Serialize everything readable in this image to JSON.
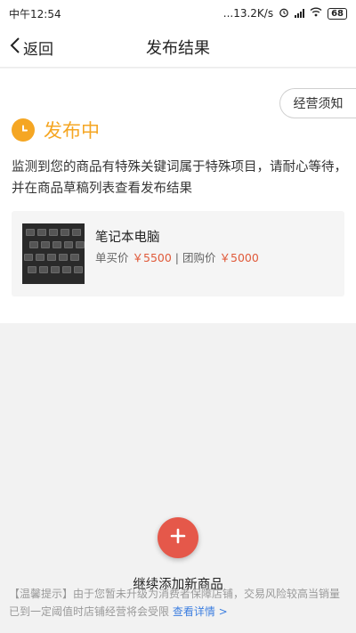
{
  "status_bar": {
    "time": "中午12:54",
    "network_speed": "...13.2K/s",
    "battery": "68"
  },
  "nav": {
    "back_label": "返回",
    "title": "发布结果"
  },
  "result": {
    "notice_button": "经营须知",
    "status": "发布中",
    "status_color": "#f5a623",
    "description": "监测到您的商品有特殊关键词属于特殊项目，请耐心等待，并在商品草稿列表查看发布结果"
  },
  "product": {
    "name": "笔记本电脑",
    "single_price_label": "单买价",
    "single_price": "￥5500",
    "separator": "|",
    "group_price_label": "团购价",
    "group_price": "￥5000"
  },
  "action": {
    "add_label": "继续添加新商品",
    "accent_color": "#e5584a"
  },
  "tip": {
    "text": "【温馨提示】由于您暂未升级为消费者保障店铺，交易风险较高当销量已到一定阈值时店铺经营将会受限",
    "link": "查看详情 >"
  }
}
